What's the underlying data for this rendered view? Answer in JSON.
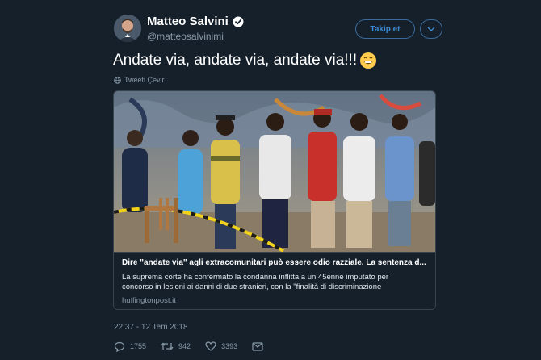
{
  "tweet": {
    "author_name": "Matteo Salvini",
    "author_handle": "@matteosalvinimi",
    "follow_label": "Takip et",
    "text": "Andate via, andate via, andate via!!!",
    "translate_label": "Tweeti Çevir",
    "timestamp": "22:37 - 12 Tem 2018"
  },
  "card": {
    "title": "Dire \"andate via\" agli extracomunitari può essere odio razziale. La sentenza d...",
    "description": "La suprema corte ha confermato la condanna inflitta a un 45enne imputato per concorso in lesioni ai danni di due stranieri, con la \"finalità di discriminazione",
    "domain": "huffingtonpost.it"
  },
  "actions": {
    "replies": "1755",
    "retweets": "942",
    "likes": "3393"
  },
  "colors": {
    "background": "#15202b",
    "accent": "#1da1f2",
    "muted": "#8899a6",
    "border": "#38444d"
  },
  "icons": [
    "avatar",
    "verified-icon",
    "chevron-down-icon",
    "emoji-grin-icon",
    "globe-icon",
    "reply-icon",
    "retweet-icon",
    "like-icon",
    "dm-icon"
  ]
}
